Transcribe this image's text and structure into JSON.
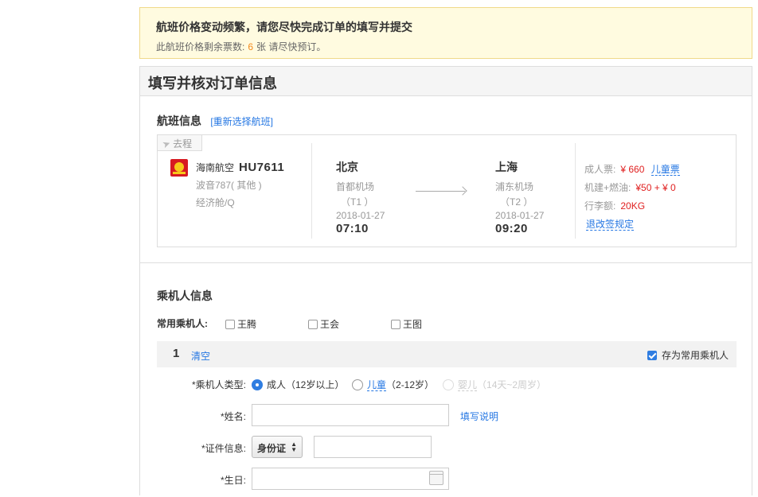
{
  "notice": {
    "title": "航班价格变动频繁，请您尽快完成订单的填写并提交",
    "remain_prefix": "此航班价格剩余票数:",
    "remain_count": "6",
    "remain_suffix": "张 请尽快预订。"
  },
  "panel": {
    "title": "填写并核对订单信息"
  },
  "flight": {
    "section_title": "航班信息",
    "reselect_link": "[重新选择航班]",
    "trip_tag": "去程",
    "airline_name": "海南航空",
    "flight_no": "HU7611",
    "aircraft": "波音787( 其他 )",
    "cabin": "经济舱/Q",
    "dep": {
      "city": "北京",
      "airport": "首都机场",
      "terminal": "（T1 ）",
      "date": "2018-01-27",
      "time": "07:10"
    },
    "arr": {
      "city": "上海",
      "airport": "浦东机场",
      "terminal": "（T2 ）",
      "date": "2018-01-27",
      "time": "09:20"
    },
    "price": {
      "adult_label": "成人票:",
      "adult_value": "¥ 660",
      "child_link": "儿童票",
      "tax_label": "机建+燃油:",
      "tax_value": "¥50 + ¥ 0",
      "baggage_label": "行李额:",
      "baggage_value": "20KG",
      "rule_link": "退改签规定"
    }
  },
  "passenger": {
    "section_title": "乘机人信息",
    "frequent_label": "常用乘机人:",
    "frequent": [
      "王腾",
      "王会",
      "王图"
    ],
    "index": "1",
    "clear_link": "清空",
    "save_label": "存为常用乘机人",
    "type_label": "乘机人类型:",
    "type_adult": "成人（12岁以上）",
    "type_child": "儿童",
    "type_child_age": "（2-12岁）",
    "type_infant": "婴儿",
    "type_infant_age": "（14天~2周岁）",
    "name_label": "姓名:",
    "name_help": "填写说明",
    "id_label": "证件信息:",
    "id_type": "身份证",
    "birthday_label": "生日:"
  },
  "colors": {
    "accent": "#2577e3",
    "price_red": "#e02020",
    "notice_bg": "#fffbe0",
    "count_orange": "#f38a1d"
  }
}
